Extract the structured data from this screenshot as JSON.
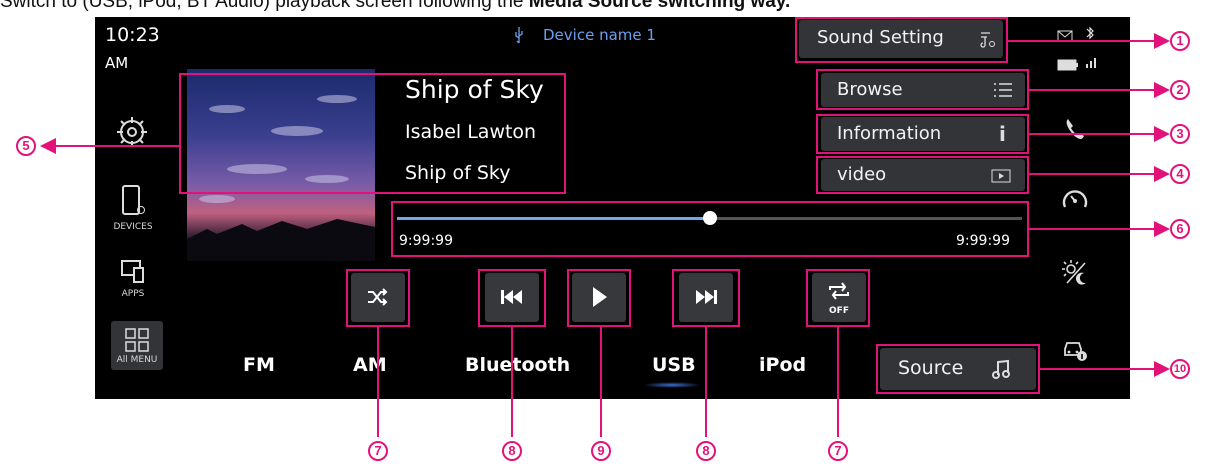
{
  "caption": {
    "text": "Switch to (USB, iPod, BT Audio) playback screen following the",
    "bold": "Media Source switching way."
  },
  "status": {
    "time": "10:23",
    "ampm": "AM",
    "device_name": "Device name 1"
  },
  "track": {
    "title": "Ship of Sky",
    "artist": "Isabel Lawton",
    "album": "Ship of Sky"
  },
  "buttons": {
    "sound_setting": "Sound Setting",
    "browse": "Browse",
    "information": "Information",
    "video": "video",
    "source": "Source"
  },
  "progress": {
    "elapsed": "9:99:99",
    "total": "9:99:99",
    "fraction": 0.5
  },
  "repeat_state": "OFF",
  "sidebar": {
    "devices": "DEVICES",
    "apps": "APPS",
    "all_menu": "All MENU"
  },
  "sources": [
    "FM",
    "AM",
    "Bluetooth",
    "USB",
    "iPod"
  ],
  "active_source": "USB",
  "callouts": {
    "n1": "1",
    "n2": "2",
    "n3": "3",
    "n4": "4",
    "n5": "5",
    "n6": "6",
    "n7": "7",
    "n8": "8",
    "n9": "9",
    "n10": "10"
  },
  "colors": {
    "accent": "#e3127b",
    "progress": "#6ea6f0",
    "device_blue": "#6aa0f0",
    "button_bg": "#333438"
  },
  "icons": [
    "usb-icon",
    "message-icon",
    "bluetooth-icon",
    "battery-icon",
    "signal-icon",
    "settings-icon",
    "devices-icon",
    "apps-icon",
    "all-menu-icon",
    "phone-icon",
    "gauge-icon",
    "brightness-icon",
    "car-info-icon",
    "music-settings-icon",
    "list-icon",
    "info-icon",
    "video-icon",
    "shuffle-icon",
    "previous-icon",
    "play-icon",
    "next-icon",
    "repeat-icon",
    "music-note-icon"
  ]
}
